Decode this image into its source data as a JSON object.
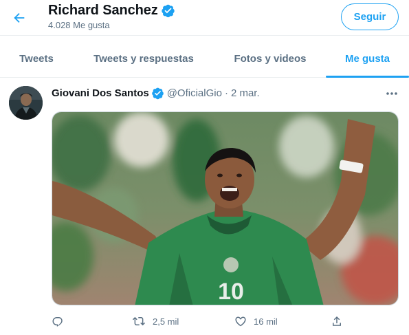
{
  "header": {
    "back_icon": "arrow-left-icon",
    "profile_name": "Richard Sanchez",
    "likes_count": "4.028 Me gusta",
    "follow_label": "Seguir"
  },
  "tabs": [
    {
      "label": "Tweets",
      "active": false
    },
    {
      "label": "Tweets y respuestas",
      "active": false
    },
    {
      "label": "Fotos y videos",
      "active": false
    },
    {
      "label": "Me gusta",
      "active": true
    }
  ],
  "tweet": {
    "author_name": "Giovani Dos Santos",
    "author_handle": "@OficialGio",
    "separator": "·",
    "date": "2 mar.",
    "media_icon": "soccer-celebration-photo",
    "actions": {
      "reply_count": "",
      "retweet_count": "2,5 mil",
      "like_count": "16 mil",
      "share_count": ""
    }
  },
  "colors": {
    "accent": "#1da1f2",
    "text_primary": "#0f1419",
    "text_secondary": "#5b7083",
    "border": "#ebeef0"
  }
}
